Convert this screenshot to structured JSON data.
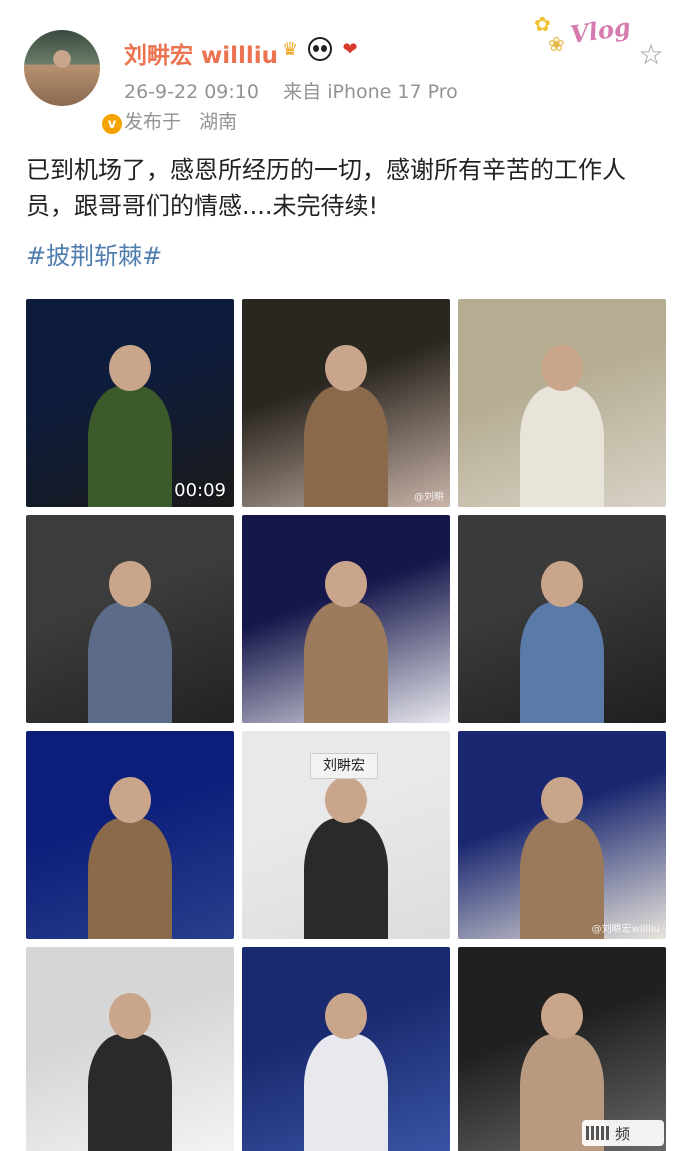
{
  "user": {
    "name": "刘畊宏 willliu",
    "avatar_icon": "avatar-portrait",
    "verified_badge": "v",
    "badges": [
      "crown-icon",
      "panda-icon",
      "lion-icon"
    ]
  },
  "post": {
    "timestamp": "26-9-22 09:10",
    "source_prefix": "来自",
    "source_device": "iPhone 17 Pro",
    "location_prefix": "发布于",
    "location": "湖南",
    "text": "已到机场了，感恩所经历的一切，感谢所有辛苦的工作人员，跟哥哥们的情感....未完待续!",
    "hashtag": "#披荆斩棘#"
  },
  "decoration": {
    "vlog_text": "Vlog"
  },
  "actions": {
    "favorite_icon": "star-icon"
  },
  "media": [
    {
      "type": "video",
      "duration": "00:09",
      "colors": [
        "#0e1c3c",
        "#3c5a2a",
        "#1a1a1a"
      ]
    },
    {
      "type": "image",
      "watermark": "@刘畊",
      "colors": [
        "#2a2620",
        "#8a6a4a",
        "#c9b4a8"
      ]
    },
    {
      "type": "image",
      "colors": [
        "#b5ad92",
        "#e8e4da",
        "#d7d2c6"
      ]
    },
    {
      "type": "image",
      "colors": [
        "#3c3c3c",
        "#5b6b88",
        "#222222"
      ]
    },
    {
      "type": "image",
      "colors": [
        "#15164a",
        "#9b7b5b",
        "#e9e9ef"
      ]
    },
    {
      "type": "image",
      "colors": [
        "#3a3a3a",
        "#5a7aa8",
        "#1f1f1f"
      ]
    },
    {
      "type": "image",
      "colors": [
        "#0c1e7a",
        "#8a6a4a",
        "#2a3f8c"
      ]
    },
    {
      "type": "image",
      "name_card": "刘畊宏",
      "colors": [
        "#e9e9e9",
        "#2a2a2a",
        "#dcdcdc"
      ]
    },
    {
      "type": "image",
      "watermark": "@刘畊宏willliu",
      "colors": [
        "#1a2770",
        "#9a7a5a",
        "#e9e4dc"
      ]
    },
    {
      "type": "image",
      "colors": [
        "#d6d6d6",
        "#2a2a2a",
        "#f4f4f4"
      ]
    },
    {
      "type": "image",
      "colors": [
        "#1a2a70",
        "#e8e8ee",
        "#3a55a5"
      ]
    },
    {
      "type": "image",
      "colors": [
        "#202020",
        "#b89a80",
        "#6a6a6a"
      ]
    }
  ],
  "floating": {
    "label": "频"
  }
}
